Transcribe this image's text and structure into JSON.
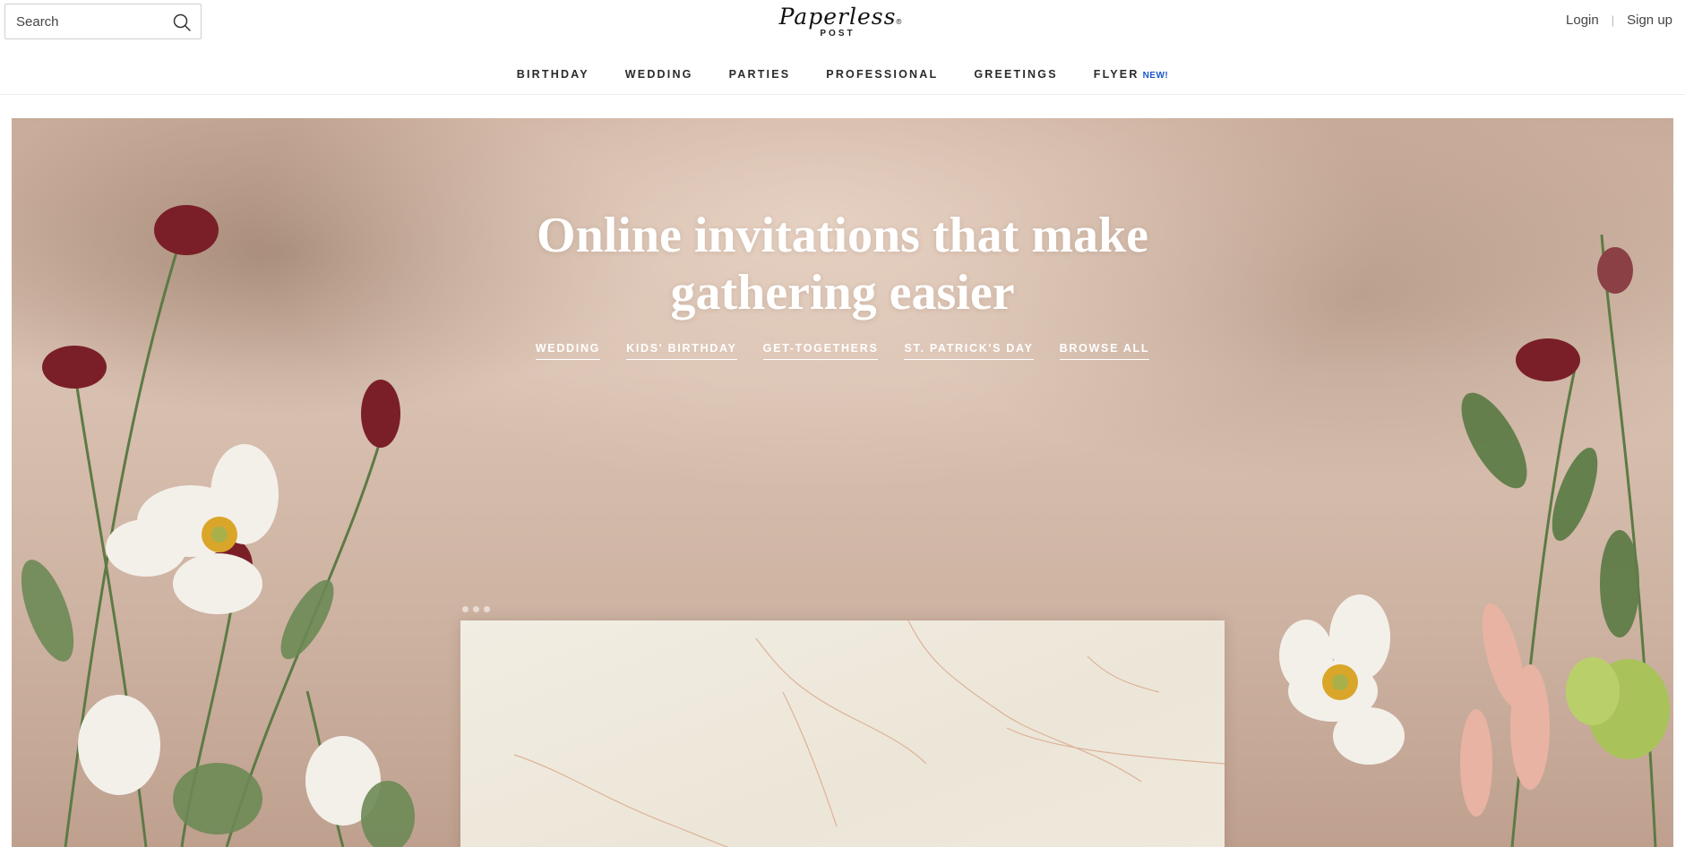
{
  "search": {
    "placeholder": "Search",
    "icon": "search-icon"
  },
  "logo": {
    "name": "Paperless",
    "sub": "POST",
    "reg": "®"
  },
  "auth": {
    "login": "Login",
    "separator": "|",
    "signup": "Sign up"
  },
  "nav": {
    "items": [
      "BIRTHDAY",
      "WEDDING",
      "PARTIES",
      "PROFESSIONAL",
      "GREETINGS",
      "FLYER"
    ],
    "new_badge": "NEW!",
    "badge_color": "#1a56c9"
  },
  "hero": {
    "title_line1": "Online invitations that make",
    "title_line2": "gathering easier",
    "links": [
      "WEDDING",
      "KIDS' BIRTHDAY",
      "GET-TOGETHERS",
      "ST. PATRICK'S DAY",
      "BROWSE ALL"
    ]
  },
  "carousel": {
    "slide_count": 3
  }
}
